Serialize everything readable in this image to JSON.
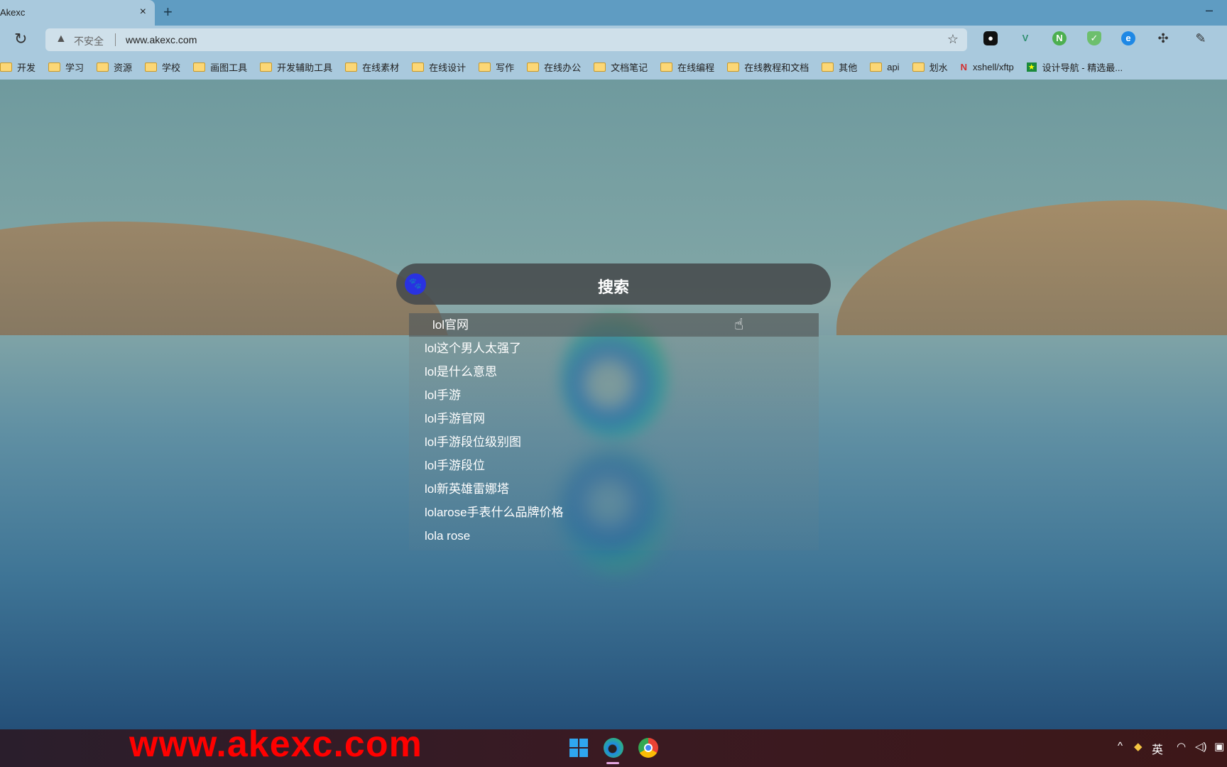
{
  "browser": {
    "tab_title": "Akexc",
    "tab_close": "×",
    "new_tab": "+",
    "minimize": "–",
    "security_label": "不安全",
    "url": "www.akexc.com",
    "icons": [
      "reload-icon",
      "warning-icon",
      "favorite-add-icon",
      "extensions-icon",
      "collections-icon"
    ]
  },
  "bookmarks": [
    {
      "label": "开发",
      "icon": "folder"
    },
    {
      "label": "学习",
      "icon": "folder"
    },
    {
      "label": "资源",
      "icon": "folder"
    },
    {
      "label": "学校",
      "icon": "folder"
    },
    {
      "label": "画图工具",
      "icon": "folder"
    },
    {
      "label": "开发辅助工具",
      "icon": "folder"
    },
    {
      "label": "在线素材",
      "icon": "folder"
    },
    {
      "label": "在线设计",
      "icon": "folder"
    },
    {
      "label": "写作",
      "icon": "folder"
    },
    {
      "label": "在线办公",
      "icon": "folder"
    },
    {
      "label": "文档笔记",
      "icon": "folder"
    },
    {
      "label": "在线编程",
      "icon": "folder"
    },
    {
      "label": "在线教程和文档",
      "icon": "folder"
    },
    {
      "label": "其他",
      "icon": "folder"
    },
    {
      "label": "api",
      "icon": "folder"
    },
    {
      "label": "划水",
      "icon": "folder"
    },
    {
      "label": "xshell/xftp",
      "icon": "netsarang"
    },
    {
      "label": "设计导航 - 精选最...",
      "icon": "shield"
    }
  ],
  "search": {
    "engine_icon": "baidu-paw-icon",
    "placeholder": "搜索",
    "engine_color": "#2932e1"
  },
  "suggestions": [
    "lol官网",
    "lol这个男人太强了",
    "lol是什么意思",
    "lol手游",
    "lol手游官网",
    "lol手游段位级别图",
    "lol手游段位",
    "lol新英雄雷娜塔",
    "lolarose手表什么品牌价格",
    "lola rose"
  ],
  "watermark": "www.akexc.com",
  "taskbar": {
    "ime": "英",
    "watermark_color": "#ff0000"
  }
}
